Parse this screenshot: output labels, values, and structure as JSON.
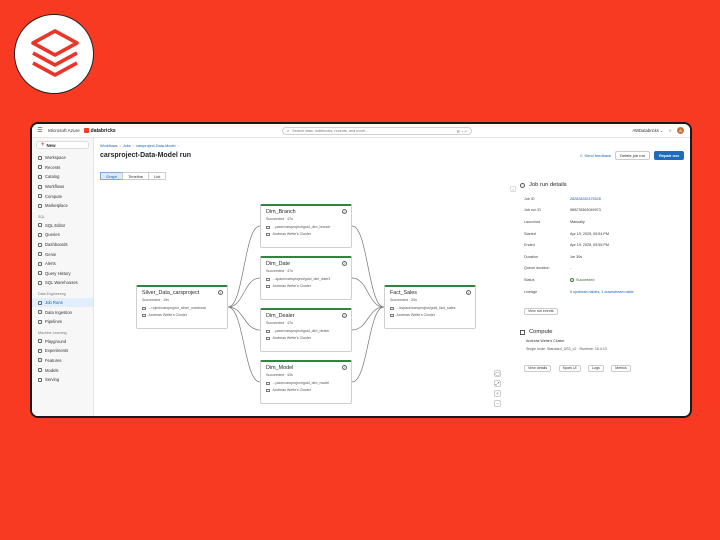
{
  "topbar": {
    "azure": "Microsoft Azure",
    "brand": "databricks",
    "search_placeholder": "Search data, notebooks, recents, and more...",
    "search_shortcut": "⌘ + P",
    "workspace": "AWDatabricks ⌄",
    "avatar_initial": "A"
  },
  "sidebar": {
    "new_label": "New",
    "main_items": [
      "Workspace",
      "Recents",
      "Catalog",
      "Workflows",
      "Compute",
      "Marketplace"
    ],
    "sql_label": "SQL",
    "sql_items": [
      "SQL Editor",
      "Queries",
      "Dashboards",
      "Genie",
      "Alerts",
      "Query History",
      "SQL Warehouses"
    ],
    "de_label": "Data Engineering",
    "de_items": [
      "Job Runs",
      "Data Ingestion",
      "Pipelines"
    ],
    "ml_label": "Machine Learning",
    "ml_items": [
      "Playground",
      "Experiments",
      "Features",
      "Models",
      "Serving"
    ]
  },
  "breadcrumb": {
    "items": [
      "Workflows",
      "Jobs",
      "carsproject-Data-Model"
    ]
  },
  "header": {
    "title": "carsproject-Data-Model run",
    "feedback": "Send feedback",
    "delete_btn": "Delete job run",
    "repair_btn": "Repair run"
  },
  "view_tabs": [
    "Graph",
    "Timeline",
    "List"
  ],
  "graph": {
    "nodes": {
      "silver": {
        "title": "Silver_Data_carsproject",
        "status": "Succeeded · 19s",
        "path": "...roject/carsproject_silver_notebook",
        "cluster": "Andreas Wette's Cluster"
      },
      "branch": {
        "title": "Dim_Branch",
        "status": "Succeeded · 47s",
        "path": "...pace/carsproject/gold_dim_branch",
        "cluster": "Andreas Wette's Cluster"
      },
      "date": {
        "title": "Dim_Date",
        "status": "Succeeded · 47s",
        "path": "...space/carsproject/gold_dim_date3",
        "cluster": "Andreas Wette's Cluster"
      },
      "dealer": {
        "title": "Dim_Dealer",
        "status": "Succeeded · 47s",
        "path": "...pace/carsproject/gold_dim_dealer",
        "cluster": "Andreas Wette's Cluster"
      },
      "model": {
        "title": "Dim_Model",
        "status": "Succeeded · 43s",
        "path": "...pace/carsproject/gold_dim_model",
        "cluster": "Andreas Wette's Cluster"
      },
      "fact": {
        "title": "Fact_Sales",
        "status": "Succeeded · 20s",
        "path": "...kspace/carsproject/gold_fact_sales",
        "cluster": "Andreas Wette's Cluster"
      }
    }
  },
  "details": {
    "title": "Job run details",
    "rows": [
      {
        "k": "Job ID",
        "v": "282828282475528"
      },
      {
        "k": "Job run ID",
        "v": "989276363049973"
      },
      {
        "k": "Launched",
        "v": "Manually"
      },
      {
        "k": "Started",
        "v": "Apr 19, 2025, 05:54 PM"
      },
      {
        "k": "Ended",
        "v": "Apr 19, 2025, 05:55 PM"
      },
      {
        "k": "Duration",
        "v": "1m 30s"
      },
      {
        "k": "Queue duration",
        "v": "-"
      },
      {
        "k": "Status",
        "v": "Succeeded"
      },
      {
        "k": "Lineage",
        "v": "5 upstream tables, 1 downstream table"
      }
    ],
    "view_events": "View run events",
    "compute_title": "Compute",
    "compute_cluster": "Andreas Wette's Cluster",
    "compute_info": "Single node: Standard_DS3_v2 · Runtime: 15.4.13",
    "compute_btns": [
      "View details",
      "Spark UI",
      "Logs",
      "Metrics"
    ]
  },
  "colors": {
    "accent": "#1d6dbd",
    "success": "#2e8540",
    "background": "#f83a22"
  }
}
